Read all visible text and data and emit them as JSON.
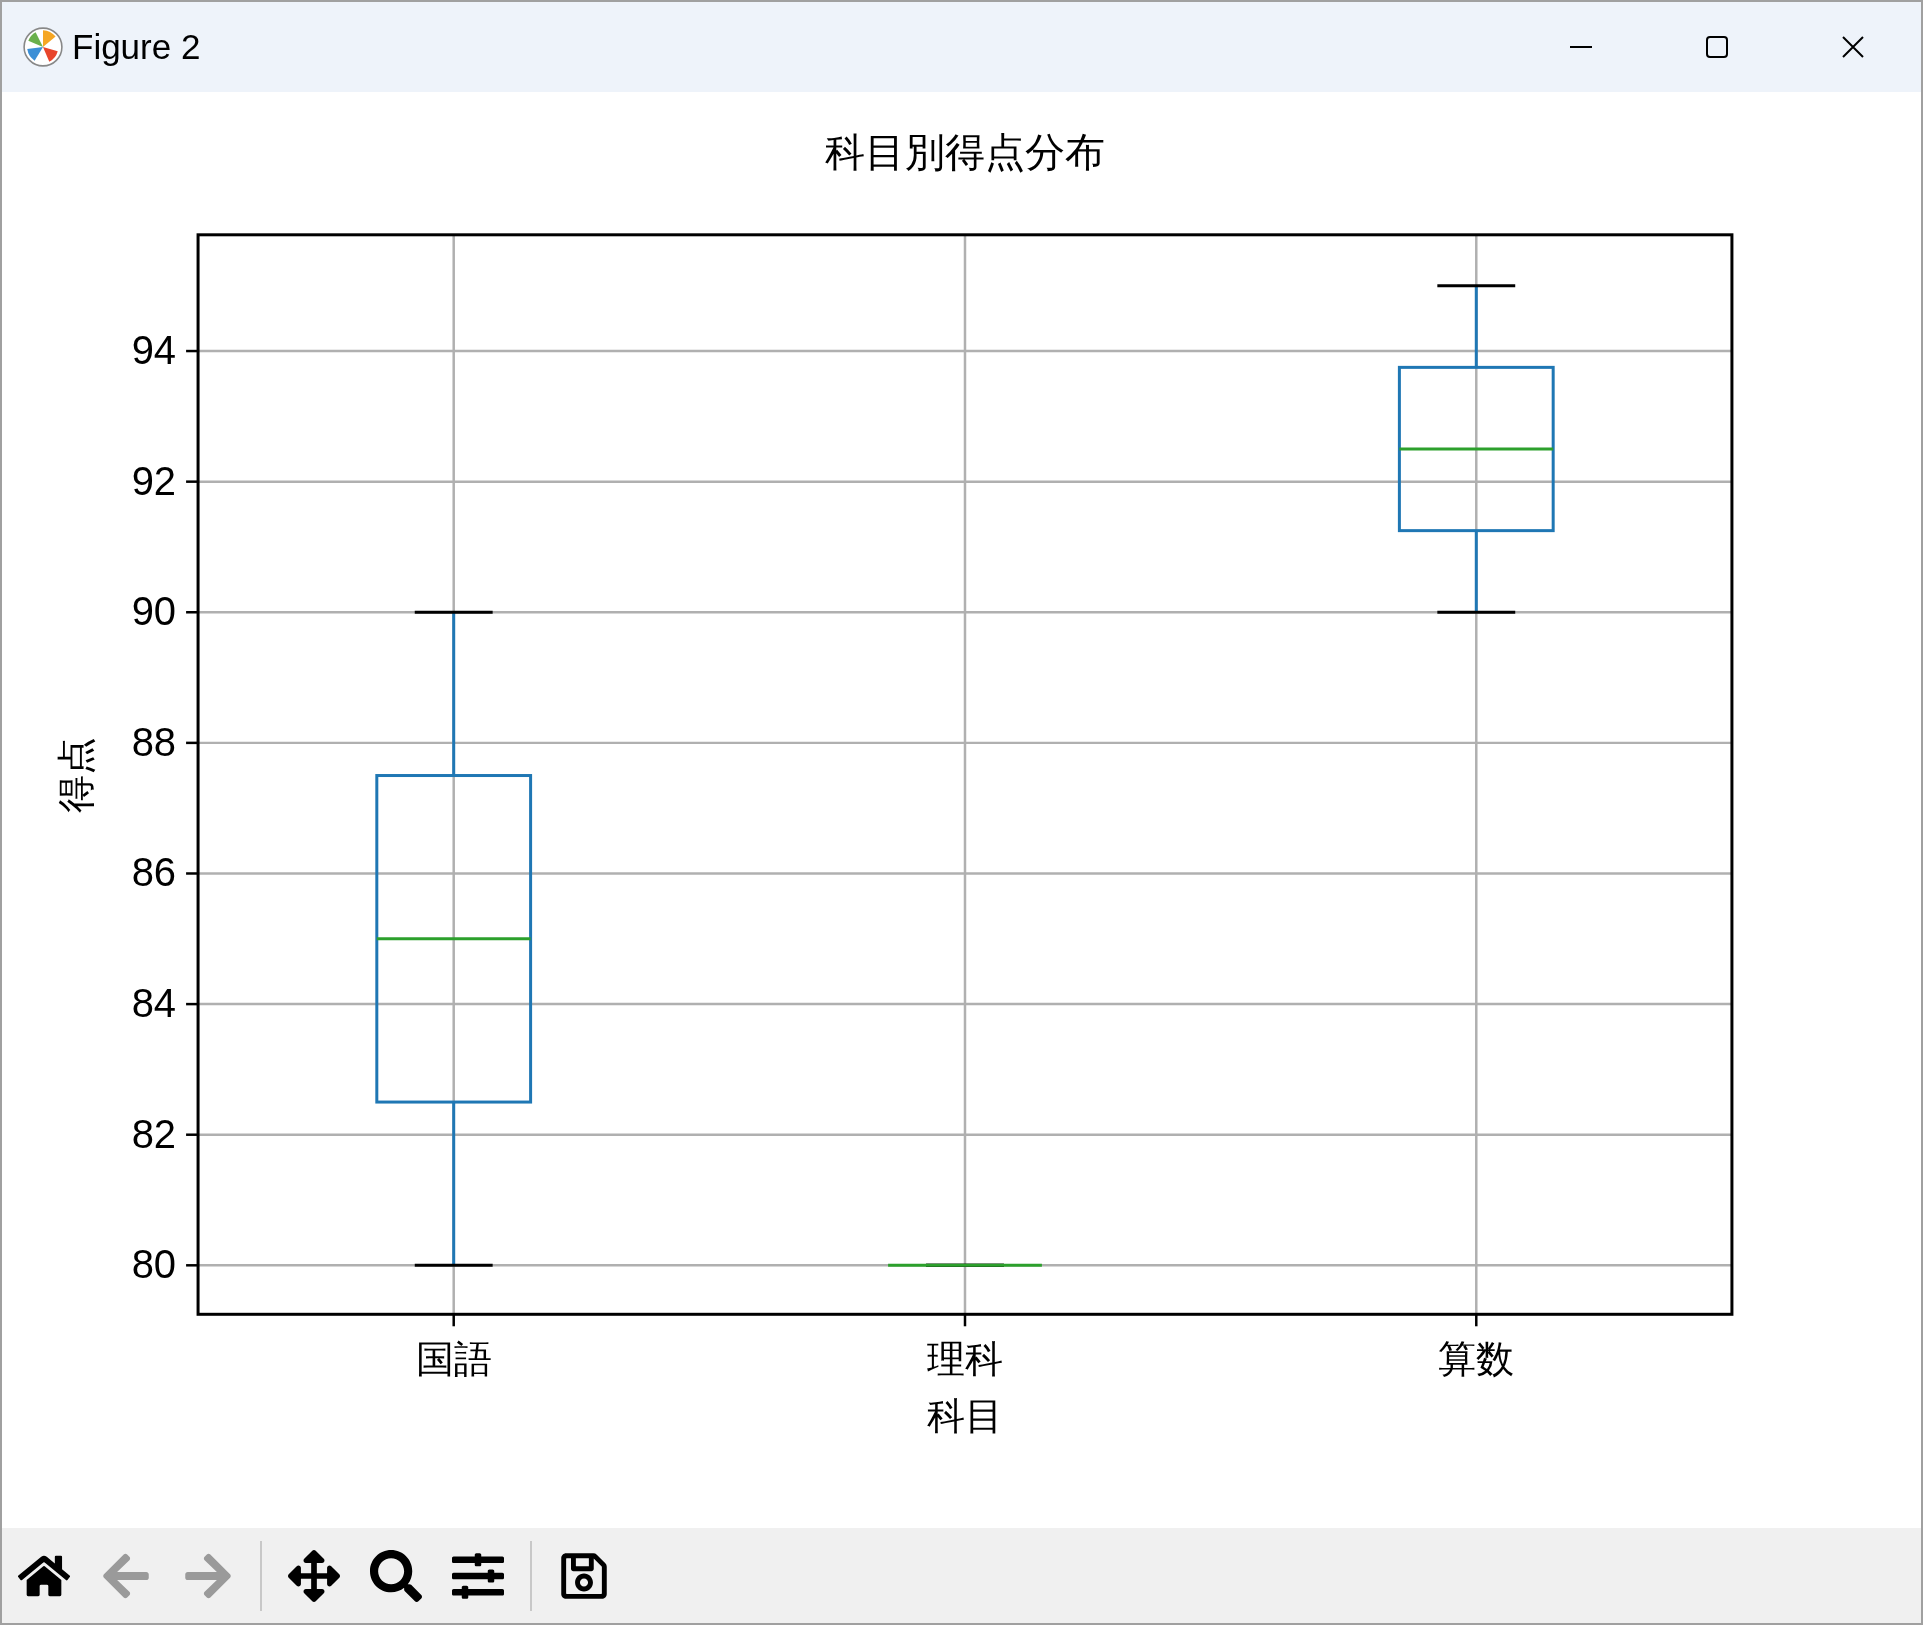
{
  "window": {
    "title": "Figure 2"
  },
  "figure": {
    "chart_data": {
      "type": "box",
      "title": "科目別得点分布",
      "xlabel": "科目",
      "ylabel": "得点",
      "categories": [
        "国語",
        "理科",
        "算数"
      ],
      "boxes": [
        {
          "low": 80,
          "q1": 82.5,
          "median": 85,
          "q3": 87.5,
          "high": 90
        },
        {
          "low": 80,
          "q1": 80,
          "median": 80,
          "q3": 80,
          "high": 80
        },
        {
          "low": 90,
          "q1": 91.25,
          "median": 92.5,
          "q3": 93.75,
          "high": 95
        }
      ],
      "grid": true,
      "ylim": [
        79.25,
        95.78
      ],
      "yticks": [
        80,
        82,
        84,
        86,
        88,
        90,
        92,
        94
      ]
    }
  }
}
